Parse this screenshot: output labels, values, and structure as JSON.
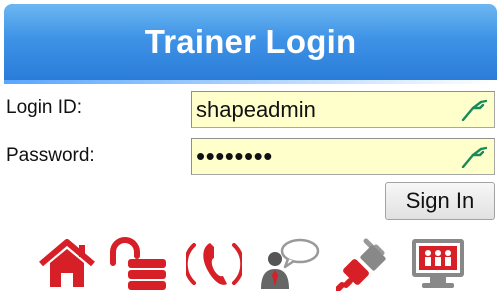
{
  "header": {
    "title": "Trainer Login"
  },
  "form": {
    "login_label": "Login ID:",
    "login_value": "shapeadmin",
    "password_label": "Password:",
    "password_value": "••••••••"
  },
  "actions": {
    "sign_in_label": "Sign In"
  },
  "colors": {
    "header_top": "#6cb7f2",
    "header_bottom": "#2a7cd9",
    "field_bg": "#ffffcc",
    "icon_red": "#d61f26",
    "key_green": "#1b8a5a"
  },
  "icons": [
    "home-icon",
    "unlock-icon",
    "phone-icon",
    "support-agent-icon",
    "plugin-icon",
    "presentation-icon"
  ]
}
